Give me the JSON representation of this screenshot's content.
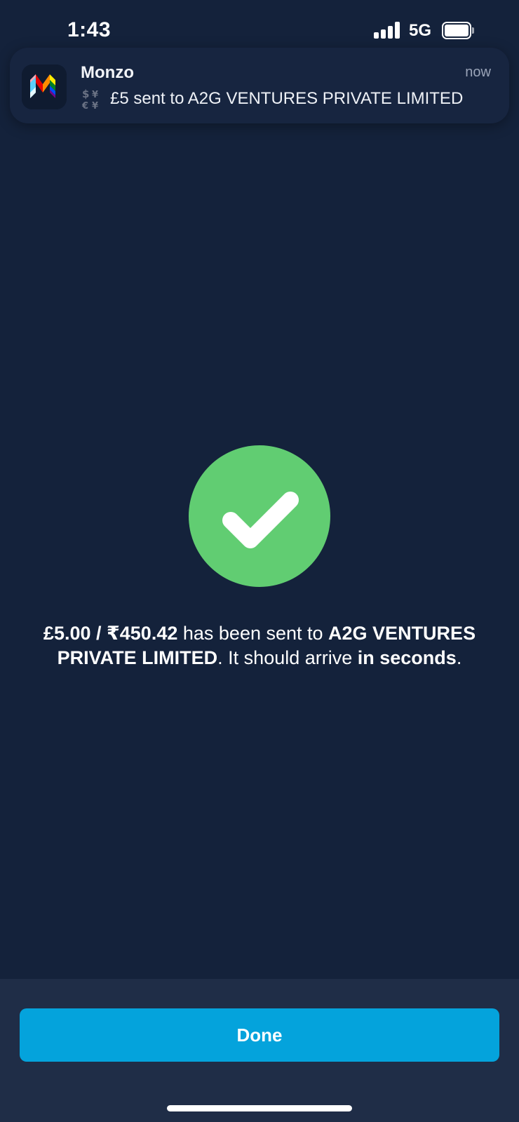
{
  "status_bar": {
    "time": "1:43",
    "network": "5G",
    "battery_level": 1.0
  },
  "notification": {
    "app_name": "Monzo",
    "time": "now",
    "icon": "currency-exchange-icon",
    "body": "£5 sent to A2G VENTURES PRIVATE LIMITED"
  },
  "success": {
    "icon": "checkmark-icon",
    "amount": "£5.00 / ₹450.42",
    "sent_text": " has been sent to ",
    "recipient": "A2G VENTURES PRIVATE LIMITED",
    "arrival_text": ". It should arrive ",
    "arrival_time": "in seconds",
    "end": "."
  },
  "actions": {
    "done_label": "Done"
  },
  "colors": {
    "background": "#14223b",
    "success_green": "#61cd72",
    "button_blue": "#04a3dc",
    "bottom_panel": "#1f2d47"
  }
}
